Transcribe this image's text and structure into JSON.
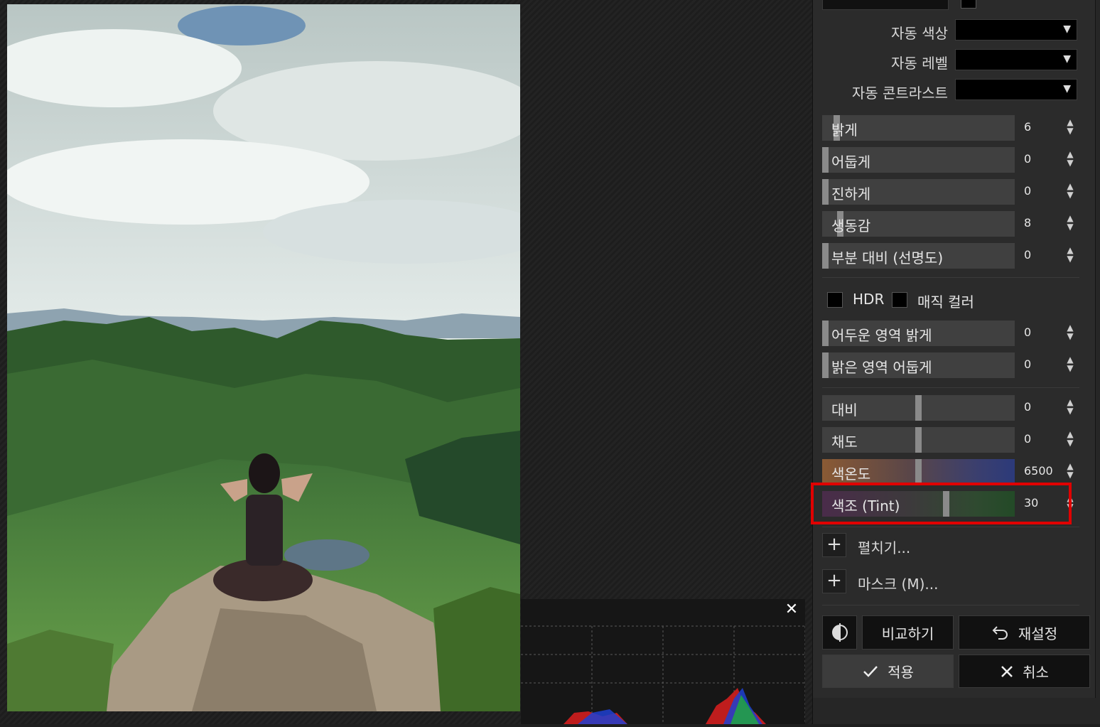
{
  "auto": [
    {
      "label": "자동 색상"
    },
    {
      "label": "자동 레벨"
    },
    {
      "label": "자동 콘트라스트"
    }
  ],
  "sliders_top": [
    {
      "label": "밝게",
      "value": "6"
    },
    {
      "label": "어둡게",
      "value": "0"
    },
    {
      "label": "진하게",
      "value": "0"
    },
    {
      "label": "생동감",
      "value": "8"
    },
    {
      "label": "부분 대비 (선명도)",
      "value": "0"
    }
  ],
  "checkboxes": {
    "hdr": "HDR",
    "magic": "매직 컬러"
  },
  "sliders_mid": [
    {
      "label": "어두운 영역 밝게",
      "value": "0"
    },
    {
      "label": "밝은 영역 어둡게",
      "value": "0"
    }
  ],
  "sliders_bottom": [
    {
      "label": "대비",
      "value": "0"
    },
    {
      "label": "채도",
      "value": "0"
    },
    {
      "label": "색온도",
      "value": "6500"
    },
    {
      "label": "색조 (Tint)",
      "value": "30"
    }
  ],
  "expand": {
    "label": "펼치기..."
  },
  "mask": {
    "label": "마스크 (M)..."
  },
  "buttons": {
    "compare": "비교하기",
    "reset": "재설정",
    "apply": "적용",
    "cancel": "취소"
  }
}
